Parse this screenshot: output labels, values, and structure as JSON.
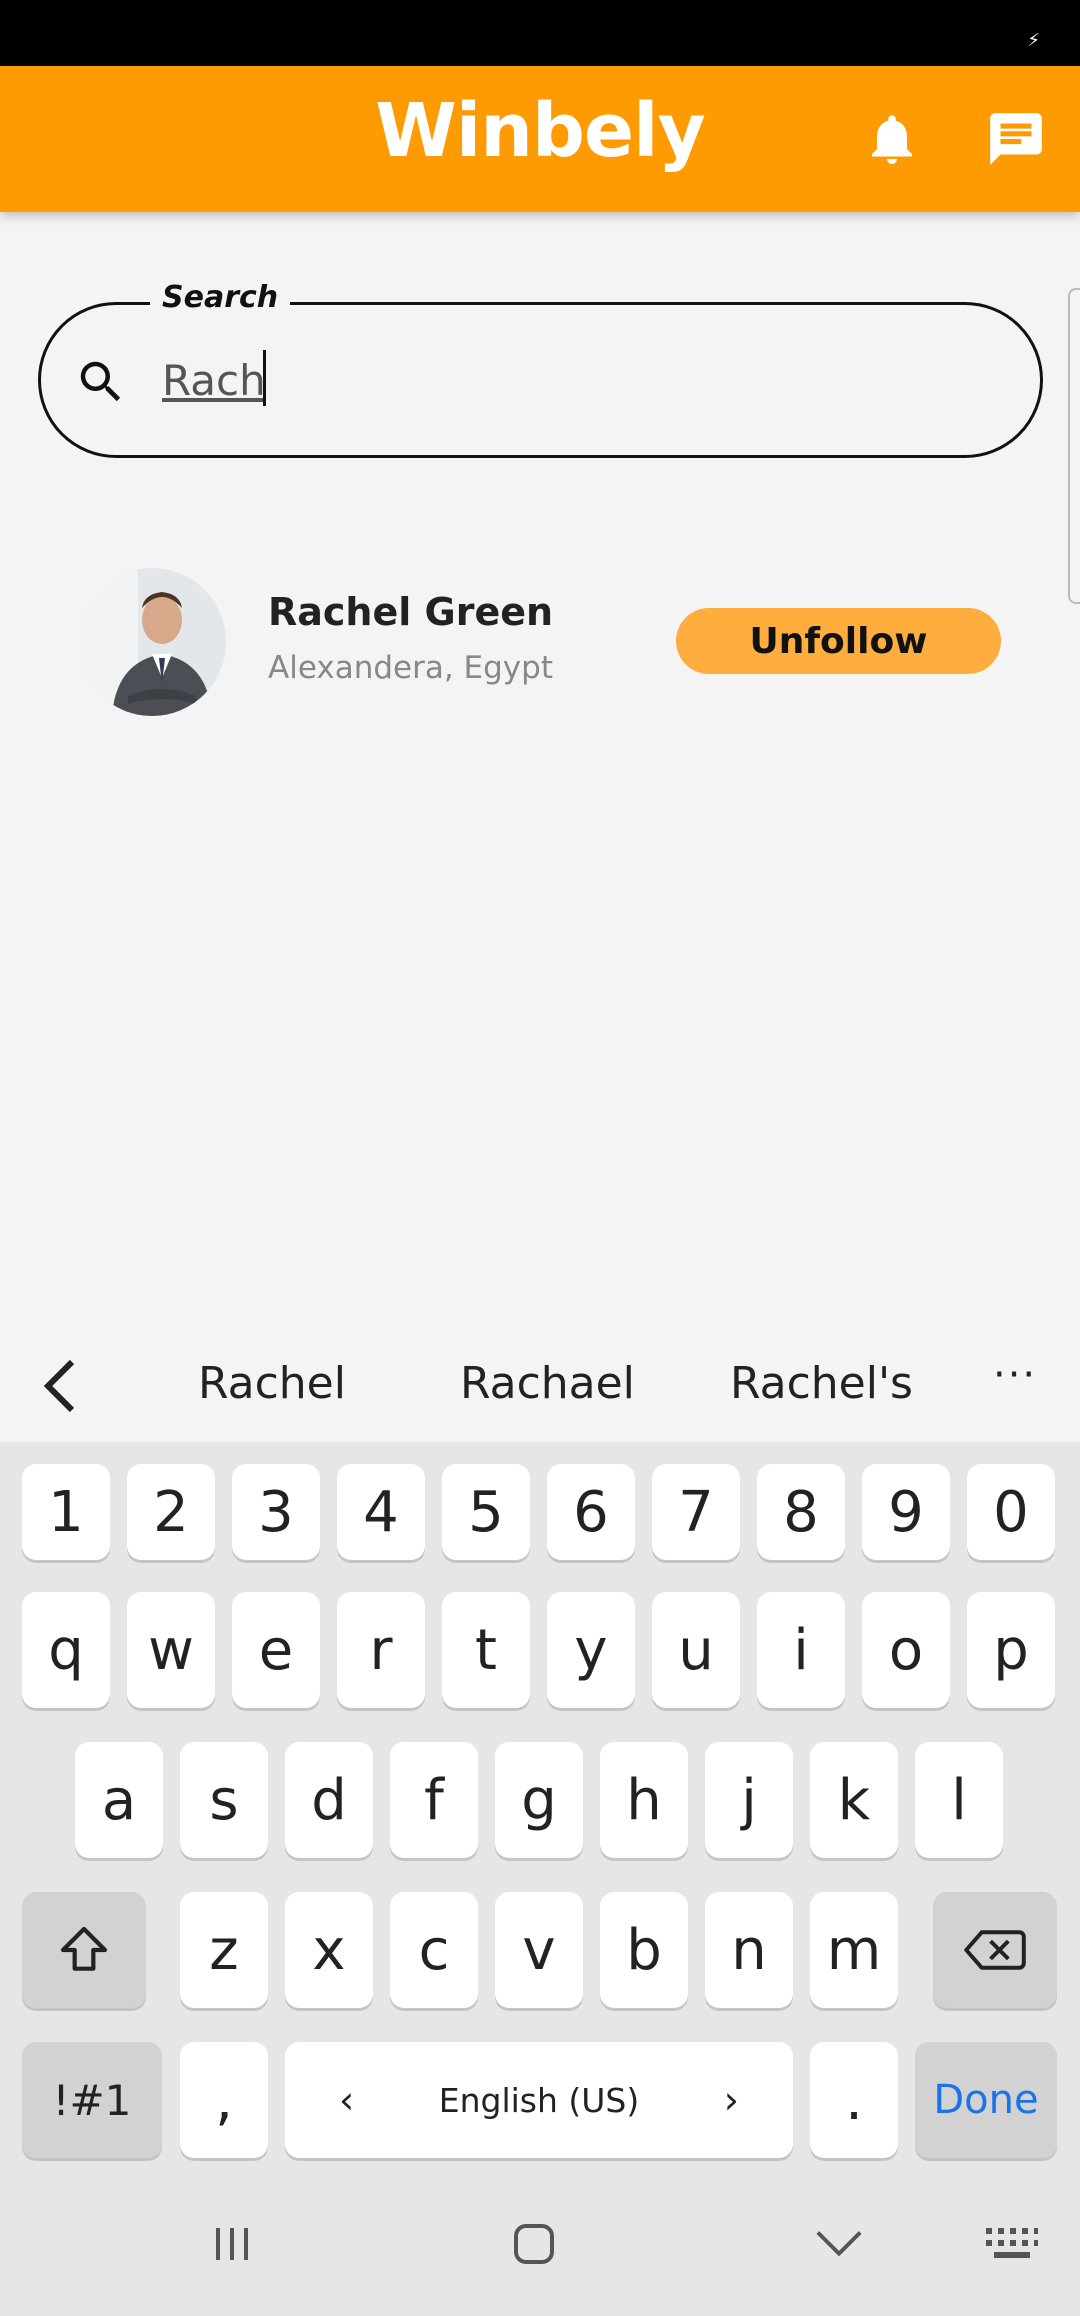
{
  "app": {
    "title": "Winbely"
  },
  "header": {
    "notifications_icon": "bell-icon",
    "messages_icon": "chat-icon"
  },
  "search": {
    "label": "Search",
    "value": "Rach",
    "icon": "search-icon"
  },
  "results": [
    {
      "name": "Rachel Green",
      "location": "Alexandera, Egypt",
      "action_label": "Unfollow"
    }
  ],
  "suggestions": {
    "words": [
      "Rachel",
      "Rachael",
      "Rachel's"
    ],
    "more": "···"
  },
  "keyboard": {
    "row_numbers": [
      "1",
      "2",
      "3",
      "4",
      "5",
      "6",
      "7",
      "8",
      "9",
      "0"
    ],
    "row_top": [
      "q",
      "w",
      "e",
      "r",
      "t",
      "y",
      "u",
      "i",
      "o",
      "p"
    ],
    "row_middle": [
      "a",
      "s",
      "d",
      "f",
      "g",
      "h",
      "j",
      "k",
      "l"
    ],
    "row_bottom": [
      "z",
      "x",
      "c",
      "v",
      "b",
      "n",
      "m"
    ],
    "symbols_label": "!#1",
    "comma_label": ",",
    "space_label": "English (US)",
    "period_label": ".",
    "done_label": "Done"
  },
  "colors": {
    "brand": "#FE9A02",
    "button": "#FEAD3E",
    "done_text": "#1a73e8"
  }
}
